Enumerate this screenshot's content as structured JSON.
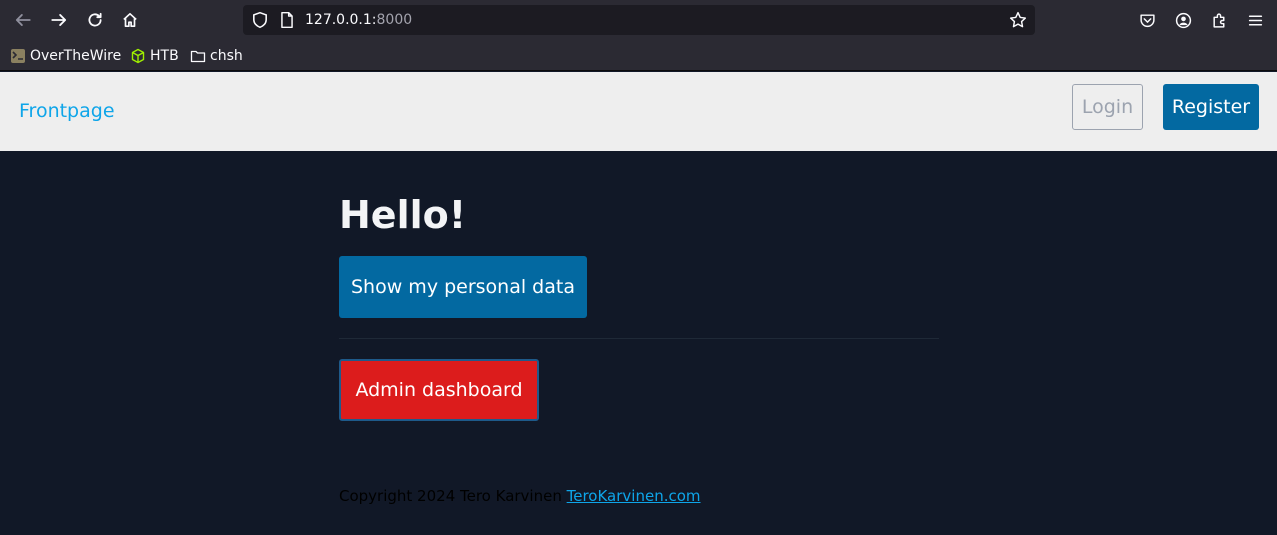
{
  "browser": {
    "url_host": "127.0.0.1:",
    "url_port": "8000",
    "bookmarks": [
      {
        "label": "OverTheWire",
        "icon": "overthewire-icon"
      },
      {
        "label": "HTB",
        "icon": "htb-cube-icon"
      },
      {
        "label": "chsh",
        "icon": "folder-icon"
      }
    ]
  },
  "header": {
    "frontpage_label": "Frontpage",
    "login_label": "Login",
    "register_label": "Register"
  },
  "main": {
    "heading": "Hello!",
    "personal_data_label": "Show my personal data",
    "admin_label": "Admin dashboard"
  },
  "footer": {
    "copyright": "Copyright 2024 Tero Karvinen ",
    "link_label": "TeroKarvinen.com"
  },
  "colors": {
    "header_bg": "#eeeeee",
    "main_bg": "#111827",
    "primary": "#0369a1",
    "danger": "#dc1c1c",
    "link": "#0ea5e9"
  }
}
